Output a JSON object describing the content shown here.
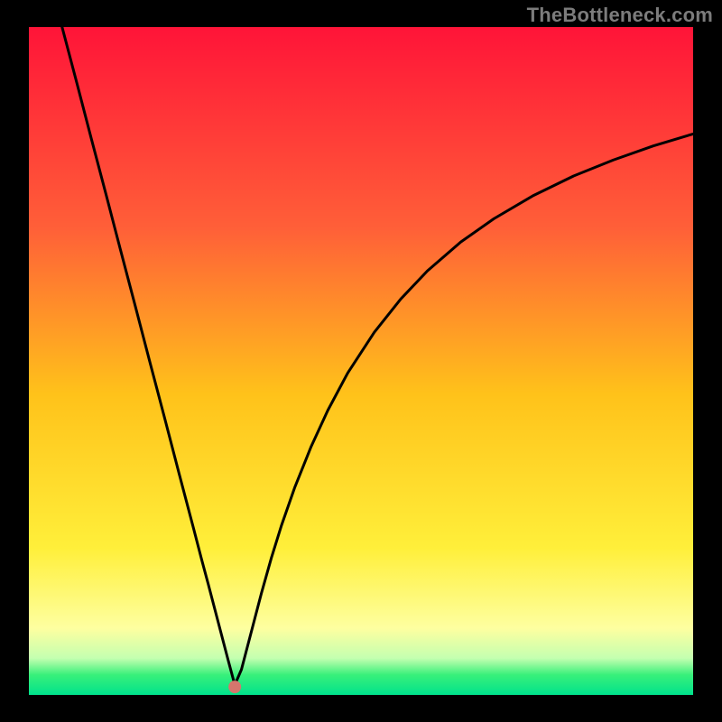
{
  "watermark": "TheBottleneck.com",
  "chart_data": {
    "type": "line",
    "title": "",
    "xlabel": "",
    "ylabel": "",
    "xlim": [
      0,
      100
    ],
    "ylim": [
      0,
      100
    ],
    "grid": false,
    "background_gradient": {
      "stops": [
        {
          "pos": 0.0,
          "color": "#ff1438"
        },
        {
          "pos": 0.3,
          "color": "#ff5f38"
        },
        {
          "pos": 0.55,
          "color": "#ffc21a"
        },
        {
          "pos": 0.78,
          "color": "#ffef3a"
        },
        {
          "pos": 0.9,
          "color": "#feffa0"
        },
        {
          "pos": 0.945,
          "color": "#c4ffb0"
        },
        {
          "pos": 0.97,
          "color": "#38f07a"
        },
        {
          "pos": 1.0,
          "color": "#00e28c"
        }
      ]
    },
    "minimum_marker": {
      "x": 31.0,
      "y": 1.2,
      "color": "#d6766d",
      "radius_px": 7
    },
    "series": [
      {
        "name": "bottleneck-curve",
        "color": "#000000",
        "x": [
          5.0,
          7.2,
          9.4,
          11.6,
          13.8,
          16.0,
          18.2,
          20.4,
          22.6,
          24.8,
          26.0,
          27.0,
          28.0,
          29.0,
          30.0,
          31.0,
          32.0,
          33.0,
          34.0,
          35.0,
          36.5,
          38.0,
          40.0,
          42.5,
          45.0,
          48.0,
          52.0,
          56.0,
          60.0,
          65.0,
          70.0,
          76.0,
          82.0,
          88.0,
          94.0,
          100.0
        ],
        "values": [
          100.0,
          91.7,
          83.3,
          75.0,
          66.6,
          58.3,
          49.9,
          41.6,
          33.2,
          24.9,
          20.3,
          16.6,
          12.8,
          9.0,
          5.2,
          1.5,
          3.8,
          7.6,
          11.4,
          15.2,
          20.5,
          25.3,
          31.0,
          37.2,
          42.6,
          48.2,
          54.3,
          59.3,
          63.5,
          67.8,
          71.3,
          74.8,
          77.7,
          80.1,
          82.2,
          84.0
        ]
      }
    ]
  }
}
